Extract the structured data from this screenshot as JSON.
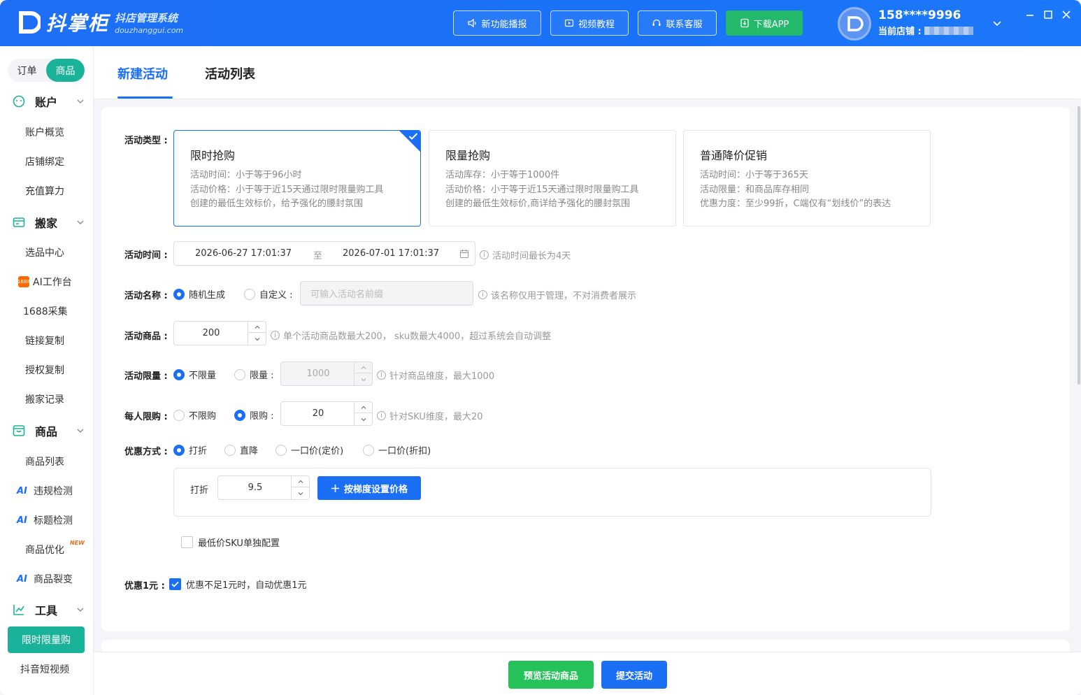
{
  "app": {
    "logo_main": "抖掌柜",
    "logo_sub": "抖店管理系统",
    "logo_domain": "douzhanggui.com"
  },
  "header": {
    "buttons": [
      {
        "label": "新功能播报",
        "icon": "speaker-icon"
      },
      {
        "label": "视频教程",
        "icon": "video-icon"
      },
      {
        "label": "联系客服",
        "icon": "headset-icon"
      },
      {
        "label": "下载APP",
        "icon": "download-icon"
      }
    ],
    "user_phone": "158****9996",
    "store_label": "当前店铺 :"
  },
  "sidebar": {
    "segments": [
      "订单",
      "商品"
    ],
    "active_segment": "商品",
    "groups": [
      {
        "label": "账户",
        "icon": "account-icon",
        "items": [
          "账户概览",
          "店铺绑定",
          "充值算力"
        ]
      },
      {
        "label": "搬家",
        "icon": "move-icon",
        "items": [
          "选品中心",
          "AI工作台",
          "1688采集",
          "链接复制",
          "授权复制",
          "搬家记录"
        ]
      },
      {
        "label": "商品",
        "icon": "goods-icon",
        "items": [
          "商品列表",
          "违规检测",
          "标题检测",
          "商品优化",
          "商品裂变"
        ]
      },
      {
        "label": "工具",
        "icon": "chart-icon",
        "items": [
          "限时限量购",
          "抖音短视频"
        ]
      }
    ],
    "ai_badge": "AI",
    "new_badge": "NEW",
    "badge_1688": "1688",
    "active_item": "限时限量购"
  },
  "tabs": [
    {
      "label": "新建活动",
      "active": true
    },
    {
      "label": "活动列表",
      "active": false
    }
  ],
  "form": {
    "type_label": "活动类型 :",
    "types": [
      {
        "title": "限时抢购",
        "lines": [
          "活动时间：小于等于96小时",
          "活动价格：小于等于近15天通过限时限量购工具",
          "创建的最低生效标价，给予强化的腰封氛围"
        ],
        "selected": true
      },
      {
        "title": "限量抢购",
        "lines": [
          "活动库存：小于等于1000件",
          "活动价格：小于等于近15天通过限时限量购工具",
          "创建的最低生效标价,商详给予强化的腰封氛围"
        ],
        "selected": false
      },
      {
        "title": "普通降价促销",
        "lines": [
          "活动时间：小于等于365天",
          "活动限量：和商品库存相同",
          "优惠力度：至少99折，C端仅有“划线价”的表达"
        ],
        "selected": false
      }
    ],
    "time_label": "活动时间 :",
    "time_start": "2026-06-27 17:01:37",
    "time_to": "至",
    "time_end": "2026-07-01 17:01:37",
    "time_hint": "活动时间最长为4天",
    "name_label": "活动名称 :",
    "name_opt_random": "随机生成",
    "name_opt_custom": "自定义 :",
    "name_placeholder": "可输入活动名前缀",
    "name_hint": "该名称仅用于管理，不对消费者展示",
    "goods_label": "活动商品 :",
    "goods_value": "200",
    "goods_hint": "单个活动商品数最大200， sku数最大4000，超过系统会自动调整",
    "limit_label": "活动限量 :",
    "limit_opt_none": "不限量",
    "limit_opt_limit": "限量 :",
    "limit_value": "1000",
    "limit_hint": "针对商品维度，最大1000",
    "per_label": "每人限购 :",
    "per_opt_none": "不限购",
    "per_opt_limit": "限购 :",
    "per_value": "20",
    "per_hint": "针对SKU维度，最大20",
    "disc_label": "优惠方式 :",
    "disc_opts": [
      "打折",
      "直降",
      "一口价(定价)",
      "一口价(折扣)"
    ],
    "disc_field_label": "打折",
    "disc_value": "9.5",
    "tier_button": "按梯度设置价格",
    "min_sku_label": "最低价SKU单独配置",
    "yuan_label": "优惠1元 :",
    "yuan_text": "优惠不足1元时，自动优惠1元"
  },
  "footer": {
    "preview_button": "预览活动商品",
    "submit_button": "提交活动"
  },
  "colors": {
    "primary": "#1b6ff5",
    "teal": "#1bb29a",
    "green": "#25c25a"
  }
}
